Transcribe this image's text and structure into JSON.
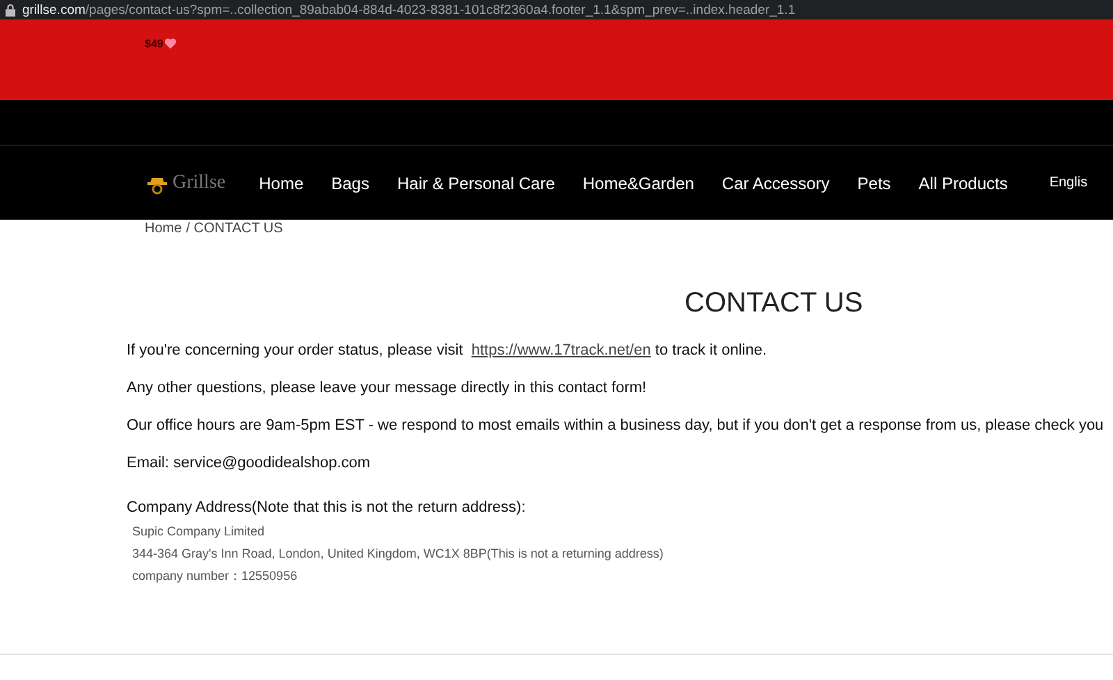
{
  "address_bar": {
    "domain": "grillse.com",
    "path": "/pages/contact-us?spm=..collection_89abab04-884d-4023-8381-101c8f2360a4.footer_1.1&spm_prev=..index.header_1.1"
  },
  "announcement": {
    "text": "$49"
  },
  "nav": {
    "logo": "Grillse",
    "items": [
      {
        "label": "Home"
      },
      {
        "label": "Bags"
      },
      {
        "label": "Hair & Personal Care"
      },
      {
        "label": "Home&Garden"
      },
      {
        "label": "Car Accessory"
      },
      {
        "label": "Pets"
      },
      {
        "label": "All Products"
      }
    ],
    "language": "Englis"
  },
  "breadcrumb": {
    "home": "Home",
    "current": "/ CONTACT US"
  },
  "title": "CONTACT US",
  "paragraphs": [
    {
      "before": "If you're concerning your order status, please visit ",
      "link": "https://www.17track.net/en",
      "after": " to track it online."
    },
    {
      "before": "Any other questions, please leave your message directly in this contact form!"
    },
    {
      "before": "Our office hours are 9am-5pm EST - we respond to most emails within a business day, but if you don't get a response from us, please check you"
    },
    {
      "before": "Email: service@goodidealshop.com"
    }
  ],
  "address": {
    "heading": "Company Address(Note that this is not the return address):",
    "lines": [
      "Supic Company Limited",
      "344-364 Gray's Inn Road, London, United Kingdom, WC1X 8BP(This is not a returning address)",
      "company number：12550956"
    ]
  }
}
